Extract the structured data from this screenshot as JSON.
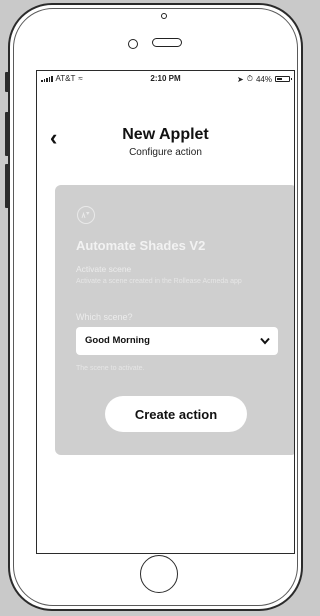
{
  "status_bar": {
    "carrier": "AT&T",
    "time": "2:10 PM",
    "battery": "44%",
    "battery_level": 0.44
  },
  "header": {
    "back_icon": "chevron-left-icon",
    "title": "New Applet",
    "subtitle": "Configure action"
  },
  "card": {
    "background": "#cfcfcf",
    "service_icon": "rollease-acmeda-icon",
    "applet_title": "Automate Shades V2",
    "action_title": "Activate scene",
    "action_description": "Activate a scene created in the Rollease Acmeda app",
    "field_label": "Which scene?",
    "selected_value": "Good Morning",
    "field_help": "The scene to activate.",
    "button_label": "Create action"
  }
}
